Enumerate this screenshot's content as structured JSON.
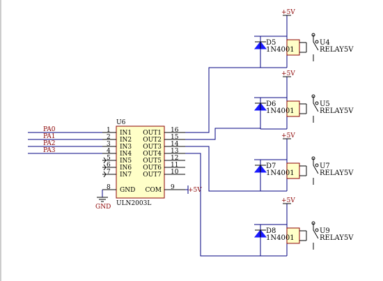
{
  "ic": {
    "designator": "U6",
    "part": "ULN2003L",
    "pins_in": [
      {
        "num": "1",
        "name": "IN1"
      },
      {
        "num": "2",
        "name": "IN2"
      },
      {
        "num": "3",
        "name": "IN3"
      },
      {
        "num": "4",
        "name": "IN4"
      },
      {
        "num": "5",
        "name": "IN5"
      },
      {
        "num": "6",
        "name": "IN6"
      },
      {
        "num": "7",
        "name": "IN7"
      },
      {
        "num": "8",
        "name": "GND"
      }
    ],
    "pins_out": [
      {
        "num": "16",
        "name": "OUT1"
      },
      {
        "num": "15",
        "name": "OUT2"
      },
      {
        "num": "14",
        "name": "OUT3"
      },
      {
        "num": "13",
        "name": "OUT4"
      },
      {
        "num": "12",
        "name": "OUT5"
      },
      {
        "num": "11",
        "name": "OUT6"
      },
      {
        "num": "10",
        "name": "OUT7"
      },
      {
        "num": "9",
        "name": "COM"
      }
    ]
  },
  "inputs": [
    "PA0",
    "PA1",
    "PA2",
    "PA3"
  ],
  "gnd_label": "GND",
  "com_power": "+5V",
  "relays": [
    {
      "diode": "D5",
      "diode_part": "1N4001",
      "relay": "U4",
      "relay_part": "RELAY5V",
      "power": "+5V"
    },
    {
      "diode": "D6",
      "diode_part": "1N4001",
      "relay": "U5",
      "relay_part": "RELAY5V",
      "power": "+5V"
    },
    {
      "diode": "D7",
      "diode_part": "1N4001",
      "relay": "U7",
      "relay_part": "RELAY5V",
      "power": "+5V"
    },
    {
      "diode": "D8",
      "diode_part": "1N4001",
      "relay": "U9",
      "relay_part": "RELAY5V",
      "power": "+5V"
    }
  ],
  "colors": {
    "wire": "#000080",
    "ic_fill": "#ffffc8",
    "ic_border": "#8b0000",
    "label": "#8b0000",
    "diode": "#1a1aff"
  }
}
